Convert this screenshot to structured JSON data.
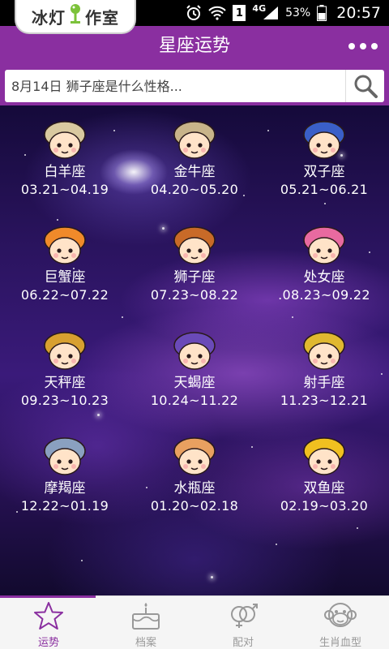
{
  "status_bar": {
    "watermark_left": "冰灯",
    "watermark_right": "作室",
    "network": "4G",
    "sim": "1",
    "battery": "53%",
    "time": "20:57"
  },
  "header": {
    "title": "星座运势"
  },
  "search": {
    "placeholder": "8月14日 狮子座是什么性格..."
  },
  "signs": [
    {
      "name": "白羊座",
      "dates": "03.21~04.19",
      "color": "#d9c9a0"
    },
    {
      "name": "金牛座",
      "dates": "04.20~05.20",
      "color": "#c8b48a"
    },
    {
      "name": "双子座",
      "dates": "05.21~06.21",
      "color": "#3a5fc8"
    },
    {
      "name": "巨蟹座",
      "dates": "06.22~07.22",
      "color": "#f08a2a"
    },
    {
      "name": "狮子座",
      "dates": "07.23~08.22",
      "color": "#c86a28"
    },
    {
      "name": "处女座",
      "dates": ".08.23~09.22",
      "color": "#e86aa0"
    },
    {
      "name": "天秤座",
      "dates": "09.23~10.23",
      "color": "#d8a030"
    },
    {
      "name": "天蝎座",
      "dates": "10.24~11.22",
      "color": "#6a4ab8"
    },
    {
      "name": "射手座",
      "dates": "11.23~12.21",
      "color": "#e0b830"
    },
    {
      "name": "摩羯座",
      "dates": "12.22~01.19",
      "color": "#8aa0c0"
    },
    {
      "name": "水瓶座",
      "dates": "01.20~02.18",
      "color": "#e8a060"
    },
    {
      "name": "双鱼座",
      "dates": "02.19~03.20",
      "color": "#f0c020"
    }
  ],
  "nav": {
    "active_color": "#8a2fa0",
    "tabs": [
      {
        "label": "运势",
        "icon": "star-icon"
      },
      {
        "label": "档案",
        "icon": "cake-icon"
      },
      {
        "label": "配对",
        "icon": "couple-icon"
      },
      {
        "label": "生肖血型",
        "icon": "monkey-icon"
      }
    ]
  }
}
